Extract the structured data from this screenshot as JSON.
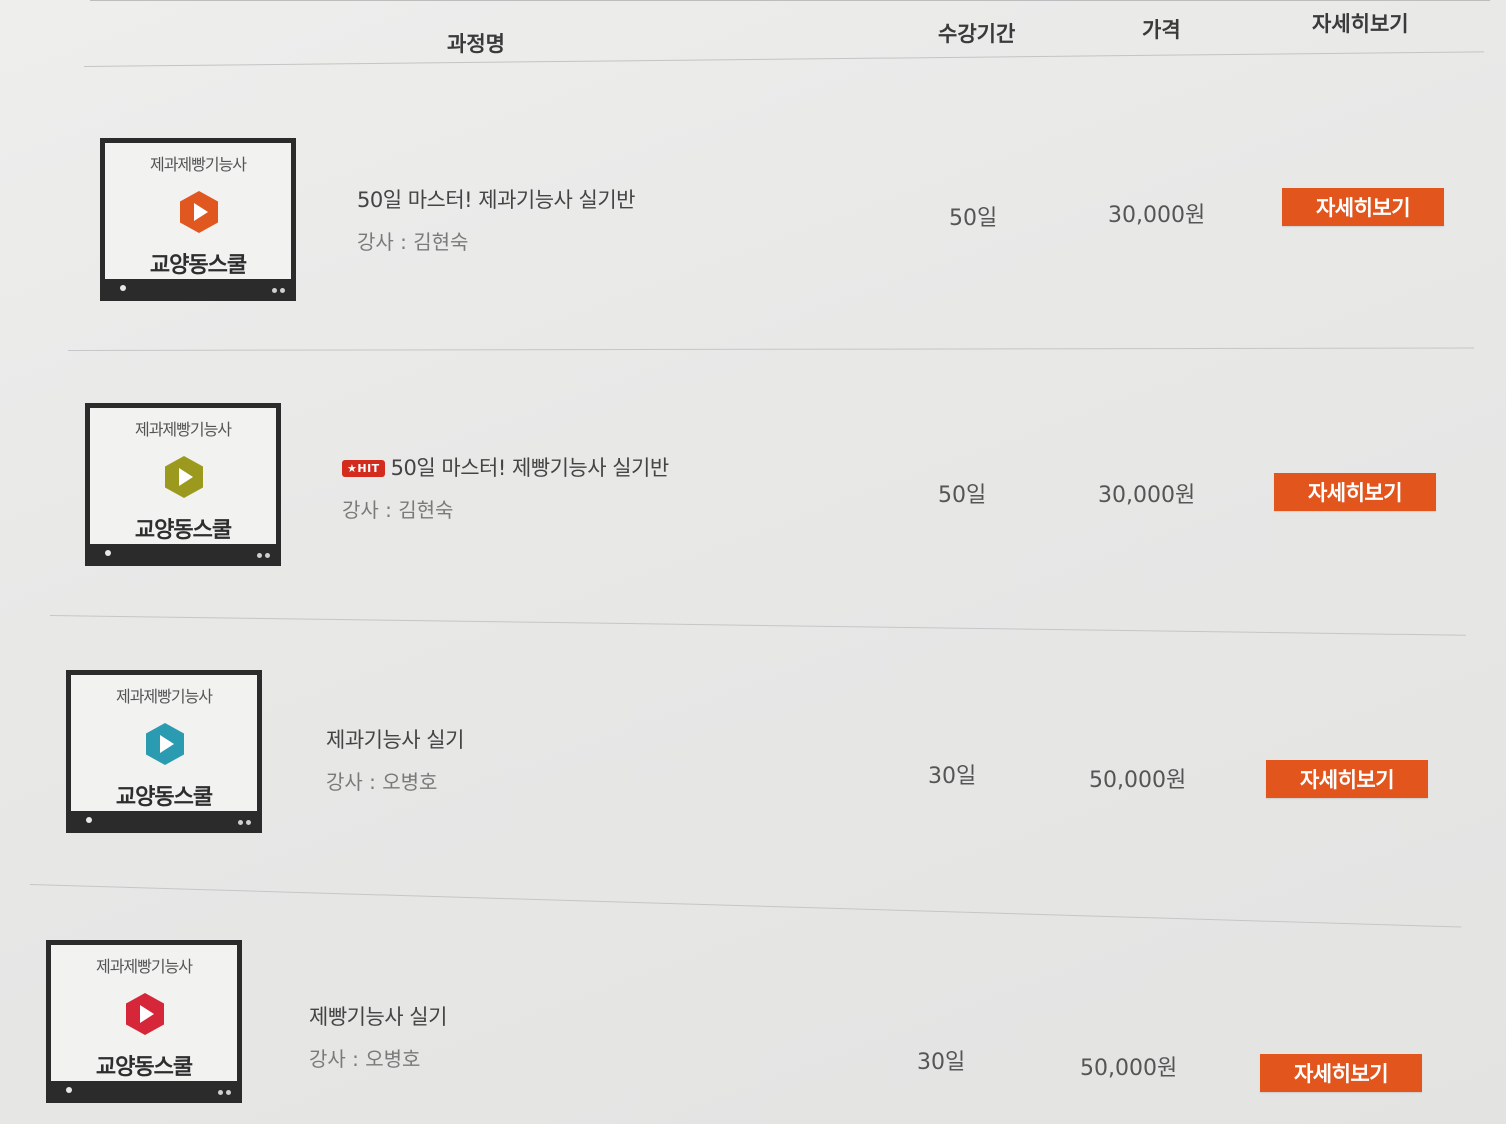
{
  "table": {
    "headers": {
      "title": "과정명",
      "period": "수강기간",
      "price": "가격",
      "detail": "자세히보기"
    },
    "courses": [
      {
        "thumbnail": {
          "category": "제과제빵기능사",
          "brand": "교양동스쿨",
          "play_color": "#e0581f",
          "icon": "play-icon"
        },
        "badge": "",
        "title": "50일 마스터! 제과기능사 실기반",
        "teacher": "강사 : 김현숙",
        "period": "50일",
        "price": "30,000원",
        "button": "자세히보기"
      },
      {
        "thumbnail": {
          "category": "제과제빵기능사",
          "brand": "교양동스쿨",
          "play_color": "#9c9a1e",
          "icon": "play-icon"
        },
        "badge": "★HIT",
        "title": "50일 마스터! 제빵기능사 실기반",
        "teacher": "강사 : 김현숙",
        "period": "50일",
        "price": "30,000원",
        "button": "자세히보기"
      },
      {
        "thumbnail": {
          "category": "제과제빵기능사",
          "brand": "교양동스쿨",
          "play_color": "#2a9bb0",
          "icon": "play-icon"
        },
        "badge": "",
        "title": "제과기능사 실기",
        "teacher": "강사 : 오병호",
        "period": "30일",
        "price": "50,000원",
        "button": "자세히보기"
      },
      {
        "thumbnail": {
          "category": "제과제빵기능사",
          "brand": "교양동스쿨",
          "play_color": "#d6263a",
          "icon": "play-icon"
        },
        "badge": "",
        "title": "제빵기능사 실기",
        "teacher": "강사 : 오병호",
        "period": "30일",
        "price": "50,000원",
        "button": "자세히보기"
      }
    ]
  },
  "colors": {
    "button": "#e2561e",
    "hit_badge": "#d32c1f"
  }
}
